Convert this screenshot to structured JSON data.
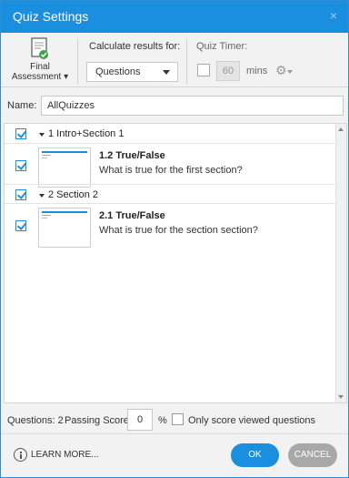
{
  "window": {
    "title": "Quiz Settings",
    "close_symbol": "×"
  },
  "toolbar": {
    "final_assessment_line1": "Final",
    "final_assessment_line2": "Assessment ▾",
    "calculate_label": "Calculate results for:",
    "calculate_selected": "Questions",
    "timer_label": "Quiz Timer:",
    "timer_value": "60",
    "timer_unit": "mins",
    "gear_icon": "gear-icon"
  },
  "name_field": {
    "label": "Name:",
    "value": "AllQuizzes"
  },
  "sections": [
    {
      "title": "1 Intro+Section 1",
      "checked": true,
      "slides": [
        {
          "title": "1.2 True/False",
          "question": "What is true for the first section?",
          "checked": true
        }
      ]
    },
    {
      "title": "2 Section 2",
      "checked": true,
      "slides": [
        {
          "title": "2.1 True/False",
          "question": "What is true for the section section?",
          "checked": true
        }
      ]
    }
  ],
  "footer": {
    "questions_label": "Questions: 2",
    "passing_label": "Passing Score:",
    "passing_value": "0",
    "percent": "%",
    "only_viewed_label": "Only score viewed questions"
  },
  "actions": {
    "learn_more": "LEARN MORE...",
    "ok": "OK",
    "cancel": "CANCEL"
  },
  "colors": {
    "accent": "#1a8fe0",
    "cancel_gray": "#a8a8a8",
    "panel_bg": "#f2f2f2"
  }
}
